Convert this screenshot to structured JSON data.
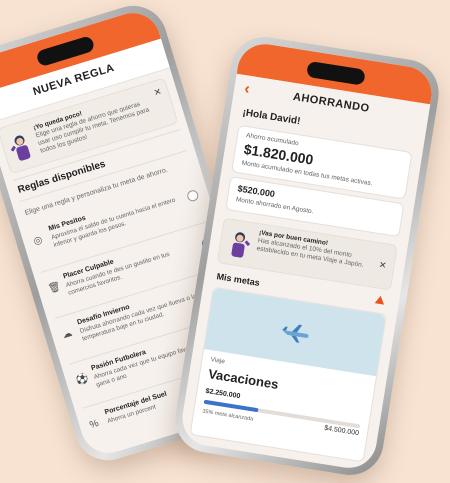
{
  "left_phone": {
    "title": "NUEVA REGLA",
    "back_icon": "chevron-left-icon",
    "banner": {
      "heading": "¡Yo queda poco!",
      "text": "Elige una regla de ahorro que quieras usar uso cumplir tu meta. Tenemos para todos los gustos!",
      "close": "✕"
    },
    "section_title": "Reglas disponibles",
    "section_subtitle": "Elige una regla y personaliza tu meta de ahorro.",
    "rules": [
      {
        "name": "Mis Pesitos",
        "desc": "Aproxima el saldo de tu cuenta hacia el entero inferior y guarda los pesos.",
        "icon": "coins-icon",
        "selected": false
      },
      {
        "name": "Placer Culpable",
        "desc": "Ahorra cuando te des un gustito en tus comercios favoritos.",
        "icon": "trash-icon",
        "selected": true
      },
      {
        "name": "Desafío Invierno",
        "desc": "Disfruta ahorrando cada vez que llueva o la temperatura baje en tu ciudad.",
        "icon": "cloud-icon",
        "selected": false
      },
      {
        "name": "Pasión Futbolera",
        "desc": "Ahorra cada vez que tu equipo favorito juega, gana o ano",
        "icon": "soccer-icon",
        "selected": false
      },
      {
        "name": "Porcentaje del Suel",
        "desc": "Ahorra un porcent",
        "icon": "percent-icon",
        "selected": false
      }
    ]
  },
  "right_phone": {
    "title": "AHORRANDO",
    "back_icon": "chevron-left-icon",
    "greeting": "¡Hola David!",
    "accumulated": {
      "label": "Ahorro acumulado",
      "amount": "$1.820.000",
      "caption": "Monto acumulado en todas tus metas activas."
    },
    "monthly": {
      "amount": "$520.000",
      "caption": "Monto ahorrado en Agosto."
    },
    "banner": {
      "heading": "¡Vas por buen camino!",
      "text": "Has alcanzado el 10% del monto establecido en tu meta Viaje a Japón.",
      "close": "✕"
    },
    "goals_title": "Mis metas",
    "goal": {
      "category": "Viaje",
      "name": "Vacaciones",
      "saved": "$2.250.000",
      "progress_label": "35% meta alcanzada",
      "target": "$4.500.000",
      "progress": 0.35
    }
  },
  "colors": {
    "accent": "#f0662c",
    "background": "#f8e3d3",
    "progress": "#3a74c8",
    "goal_image": "#cfe3ec"
  }
}
